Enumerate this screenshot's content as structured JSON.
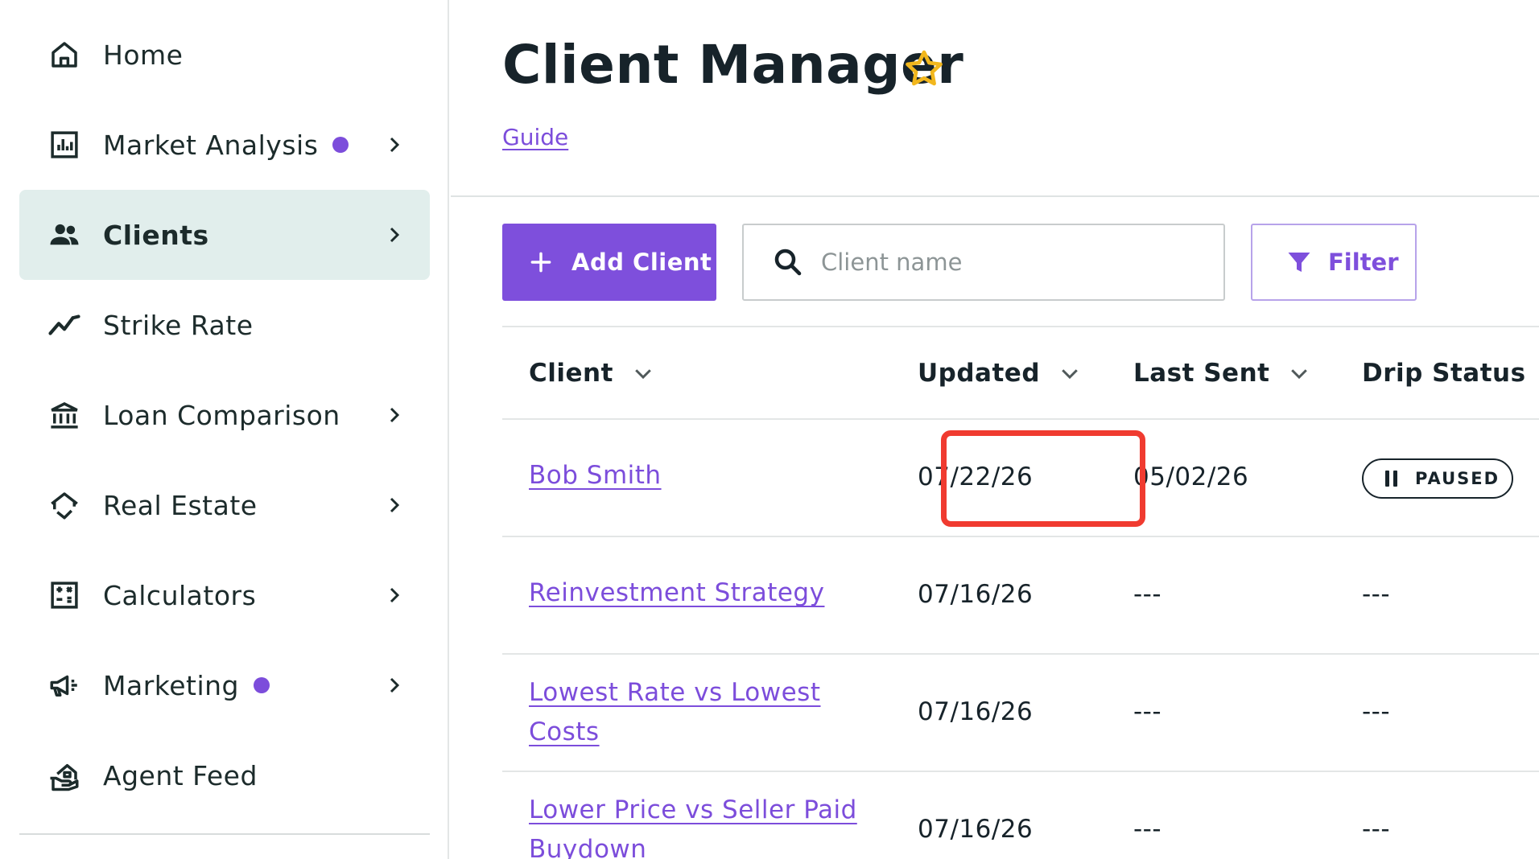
{
  "sidebar": {
    "items": [
      {
        "label": "Home",
        "icon": "home-icon"
      },
      {
        "label": "Market Analysis",
        "icon": "chart-icon",
        "dot": true,
        "chevron": true
      },
      {
        "label": "Clients",
        "icon": "users-icon",
        "chevron": true,
        "active": true
      },
      {
        "label": "Strike Rate",
        "icon": "trend-icon"
      },
      {
        "label": "Loan Comparison",
        "icon": "bank-icon",
        "chevron": true
      },
      {
        "label": "Real Estate",
        "icon": "house-arrow-icon",
        "chevron": true
      },
      {
        "label": "Calculators",
        "icon": "calculator-icon",
        "chevron": true
      },
      {
        "label": "Marketing",
        "icon": "megaphone-icon",
        "dot": true,
        "chevron": true
      },
      {
        "label": "Agent Feed",
        "icon": "agent-feed-icon"
      }
    ],
    "dot_color": "#7c4ddb"
  },
  "header": {
    "title": "Client Manager",
    "guide_link": "Guide"
  },
  "toolbar": {
    "add_label": "Add Client",
    "search_placeholder": "Client name",
    "search_value": "",
    "filter_label": "Filter"
  },
  "table": {
    "columns": [
      "Client",
      "Updated",
      "Last Sent",
      "Drip Status"
    ],
    "rows": [
      {
        "client": "Bob Smith",
        "updated": "07/22/26",
        "last_sent": "05/02/26",
        "drip_status": "PAUSED"
      },
      {
        "client": "Reinvestment Strategy",
        "updated": "07/16/26",
        "last_sent": "---",
        "drip_status": "---"
      },
      {
        "client": "Lowest Rate vs Lowest Costs",
        "updated": "07/16/26",
        "last_sent": "---",
        "drip_status": "---"
      },
      {
        "client": "Lower Price vs Seller Paid Buydown",
        "updated": "07/16/26",
        "last_sent": "---",
        "drip_status": "---"
      }
    ]
  },
  "colors": {
    "accent": "#7e4fdc",
    "active_bg": "#e1eeec",
    "highlight": "#f03b30",
    "star": "#f2b71d"
  }
}
